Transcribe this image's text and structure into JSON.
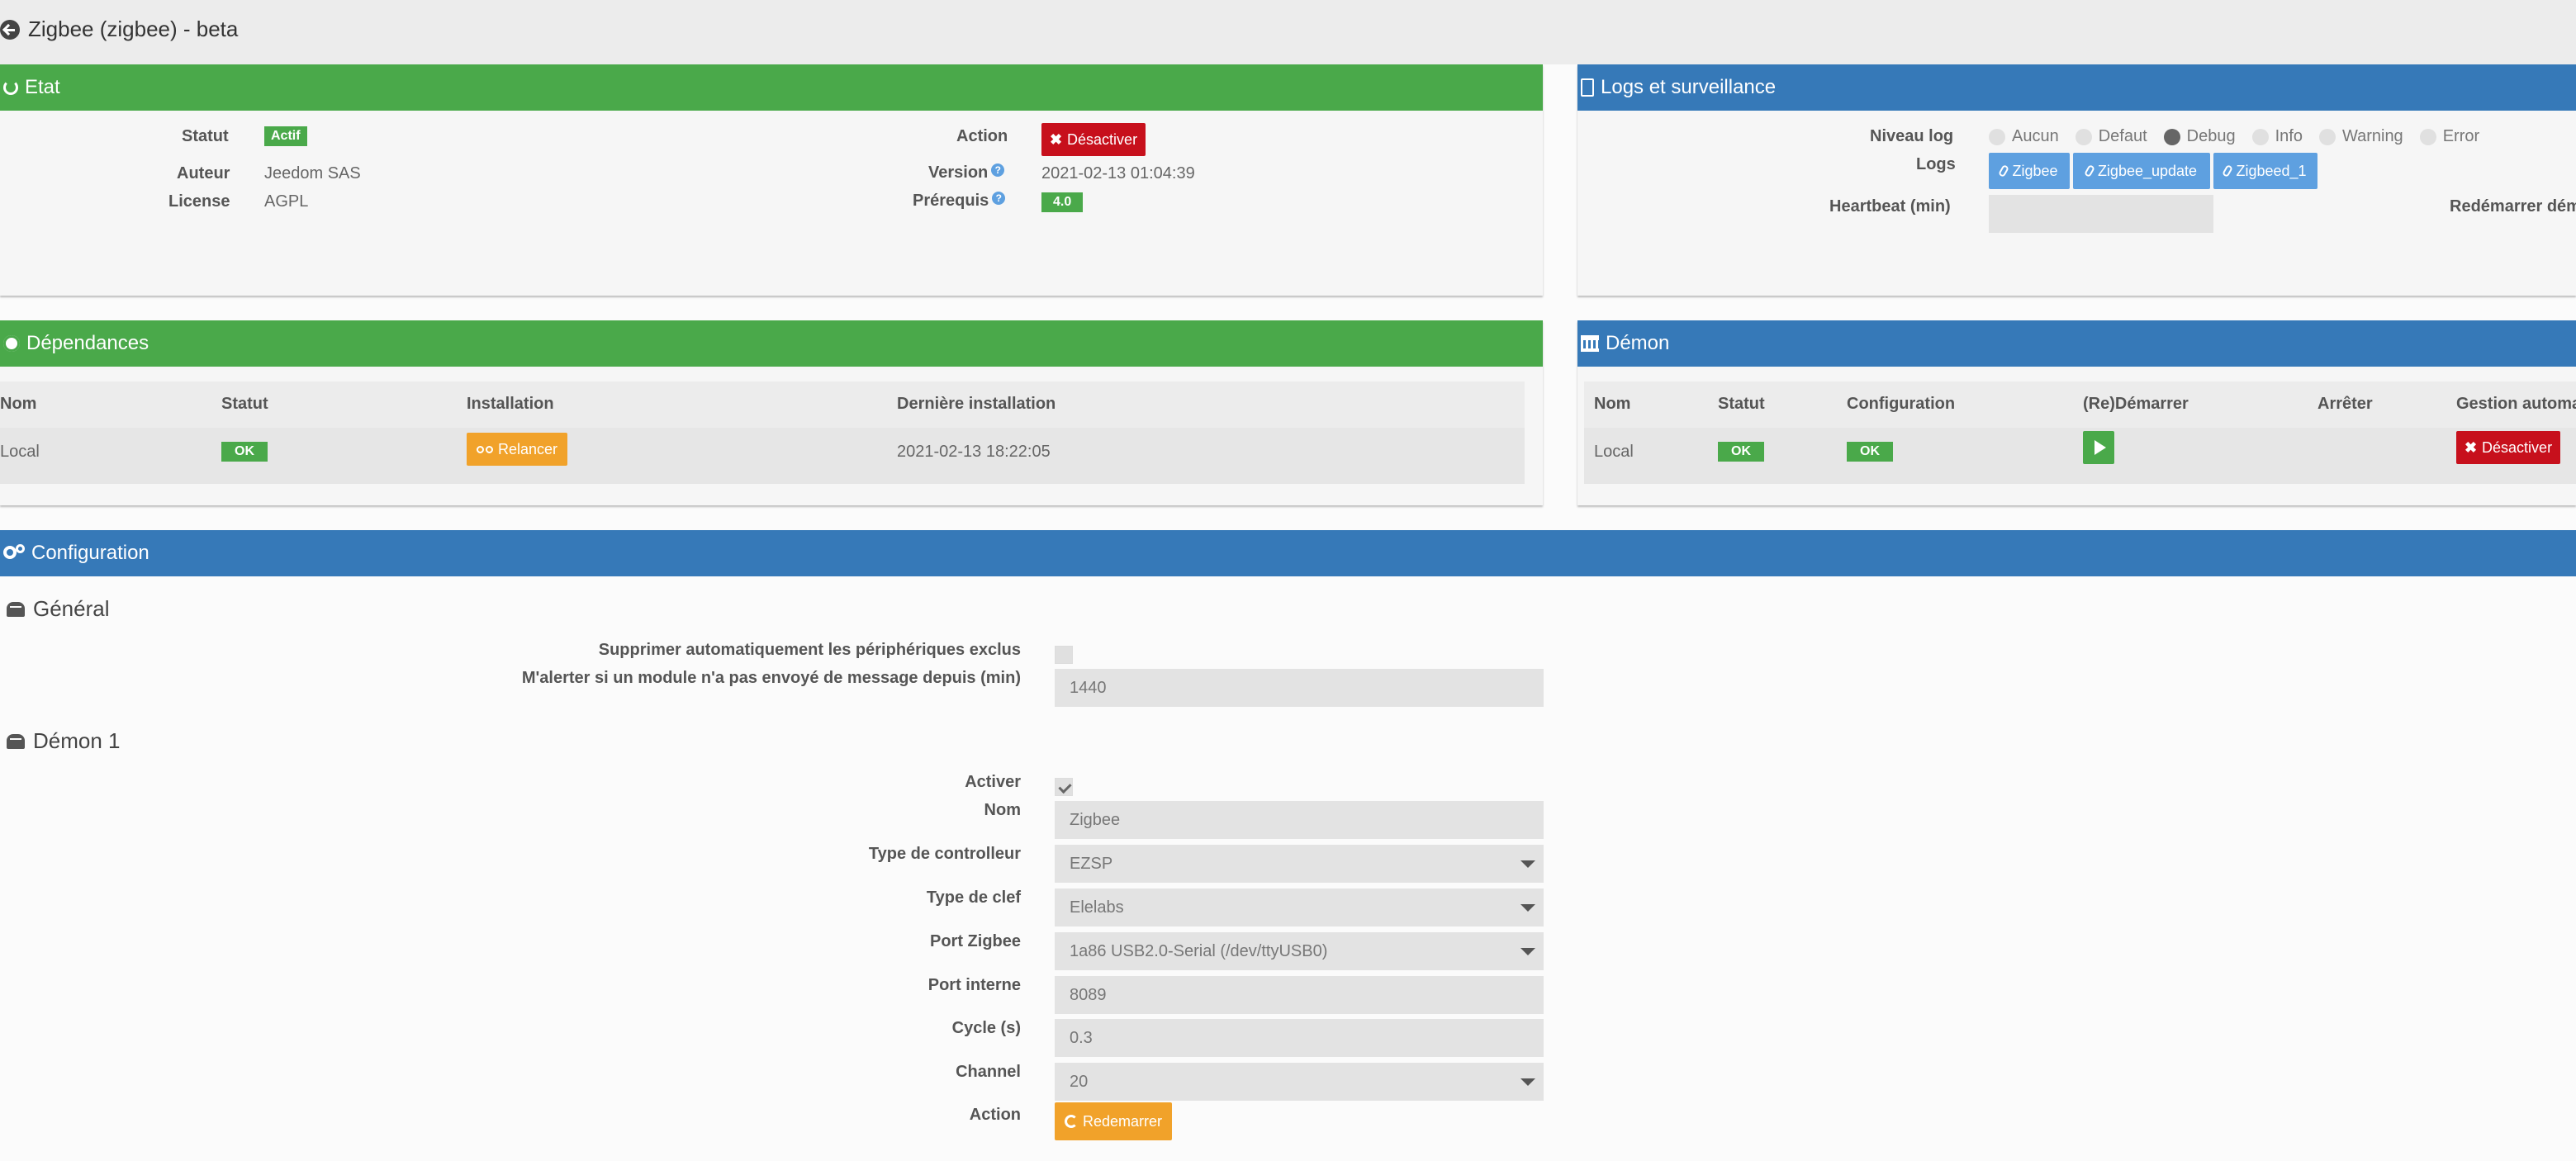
{
  "page": {
    "title": "Zigbee (zigbee) - beta"
  },
  "etat": {
    "heading": "Etat",
    "statut_label": "Statut",
    "statut_value": "Actif",
    "auteur_label": "Auteur",
    "auteur_value": "Jeedom SAS",
    "license_label": "License",
    "license_value": "AGPL",
    "action_label": "Action",
    "action_button": "Désactiver",
    "version_label": "Version",
    "version_value": "2021-02-13 01:04:39",
    "prerequis_label": "Prérequis",
    "prerequis_value": "4.0",
    "help_glyph": "?"
  },
  "logs": {
    "heading": "Logs et surveillance",
    "niveau_label": "Niveau log",
    "levels": [
      "Aucun",
      "Defaut",
      "Debug",
      "Info",
      "Warning",
      "Error"
    ],
    "selected_level": "Debug",
    "logs_label": "Logs",
    "log_buttons": [
      "Zigbee",
      "Zigbee_update",
      "Zigbeed_1"
    ],
    "heartbeat_label": "Heartbeat (min)",
    "heartbeat_value": "",
    "redemarrer_label": "Redémarrer dém"
  },
  "dependances": {
    "heading": "Dépendances",
    "columns": [
      "Nom",
      "Statut",
      "Installation",
      "Dernière installation"
    ],
    "row": {
      "nom": "Local",
      "statut": "OK",
      "installation_button": "Relancer",
      "derniere": "2021-02-13 18:22:05"
    }
  },
  "demon": {
    "heading": "Démon",
    "columns": [
      "Nom",
      "Statut",
      "Configuration",
      "(Re)Démarrer",
      "Arrêter",
      "Gestion automat"
    ],
    "row": {
      "nom": "Local",
      "statut": "OK",
      "configuration": "OK",
      "gestion_button": "Désactiver"
    }
  },
  "configuration": {
    "heading": "Configuration",
    "general": {
      "heading": "Général",
      "supprimer_label": "Supprimer automatiquement les périphériques exclus",
      "supprimer_checked": false,
      "alerter_label": "M'alerter si un module n'a pas envoyé de message depuis (min)",
      "alerter_value": "1440"
    },
    "demon1": {
      "heading": "Démon 1",
      "activer_label": "Activer",
      "activer_checked": true,
      "nom_label": "Nom",
      "nom_value": "Zigbee",
      "type_controleur_label": "Type de controlleur",
      "type_controleur_value": "EZSP",
      "type_clef_label": "Type de clef",
      "type_clef_value": "Elelabs",
      "port_zigbee_label": "Port Zigbee",
      "port_zigbee_value": "1a86 USB2.0-Serial (/dev/ttyUSB0)",
      "port_interne_label": "Port interne",
      "port_interne_value": "8089",
      "cycle_label": "Cycle (s)",
      "cycle_value": "0.3",
      "channel_label": "Channel",
      "channel_value": "20",
      "action_label": "Action",
      "action_button": "Redemarrer"
    }
  },
  "colors": {
    "green": "#4aa94a",
    "blue": "#3679b8",
    "red": "#c7101c",
    "orange": "#f1a22a",
    "lightblue": "#5ea0e0"
  }
}
